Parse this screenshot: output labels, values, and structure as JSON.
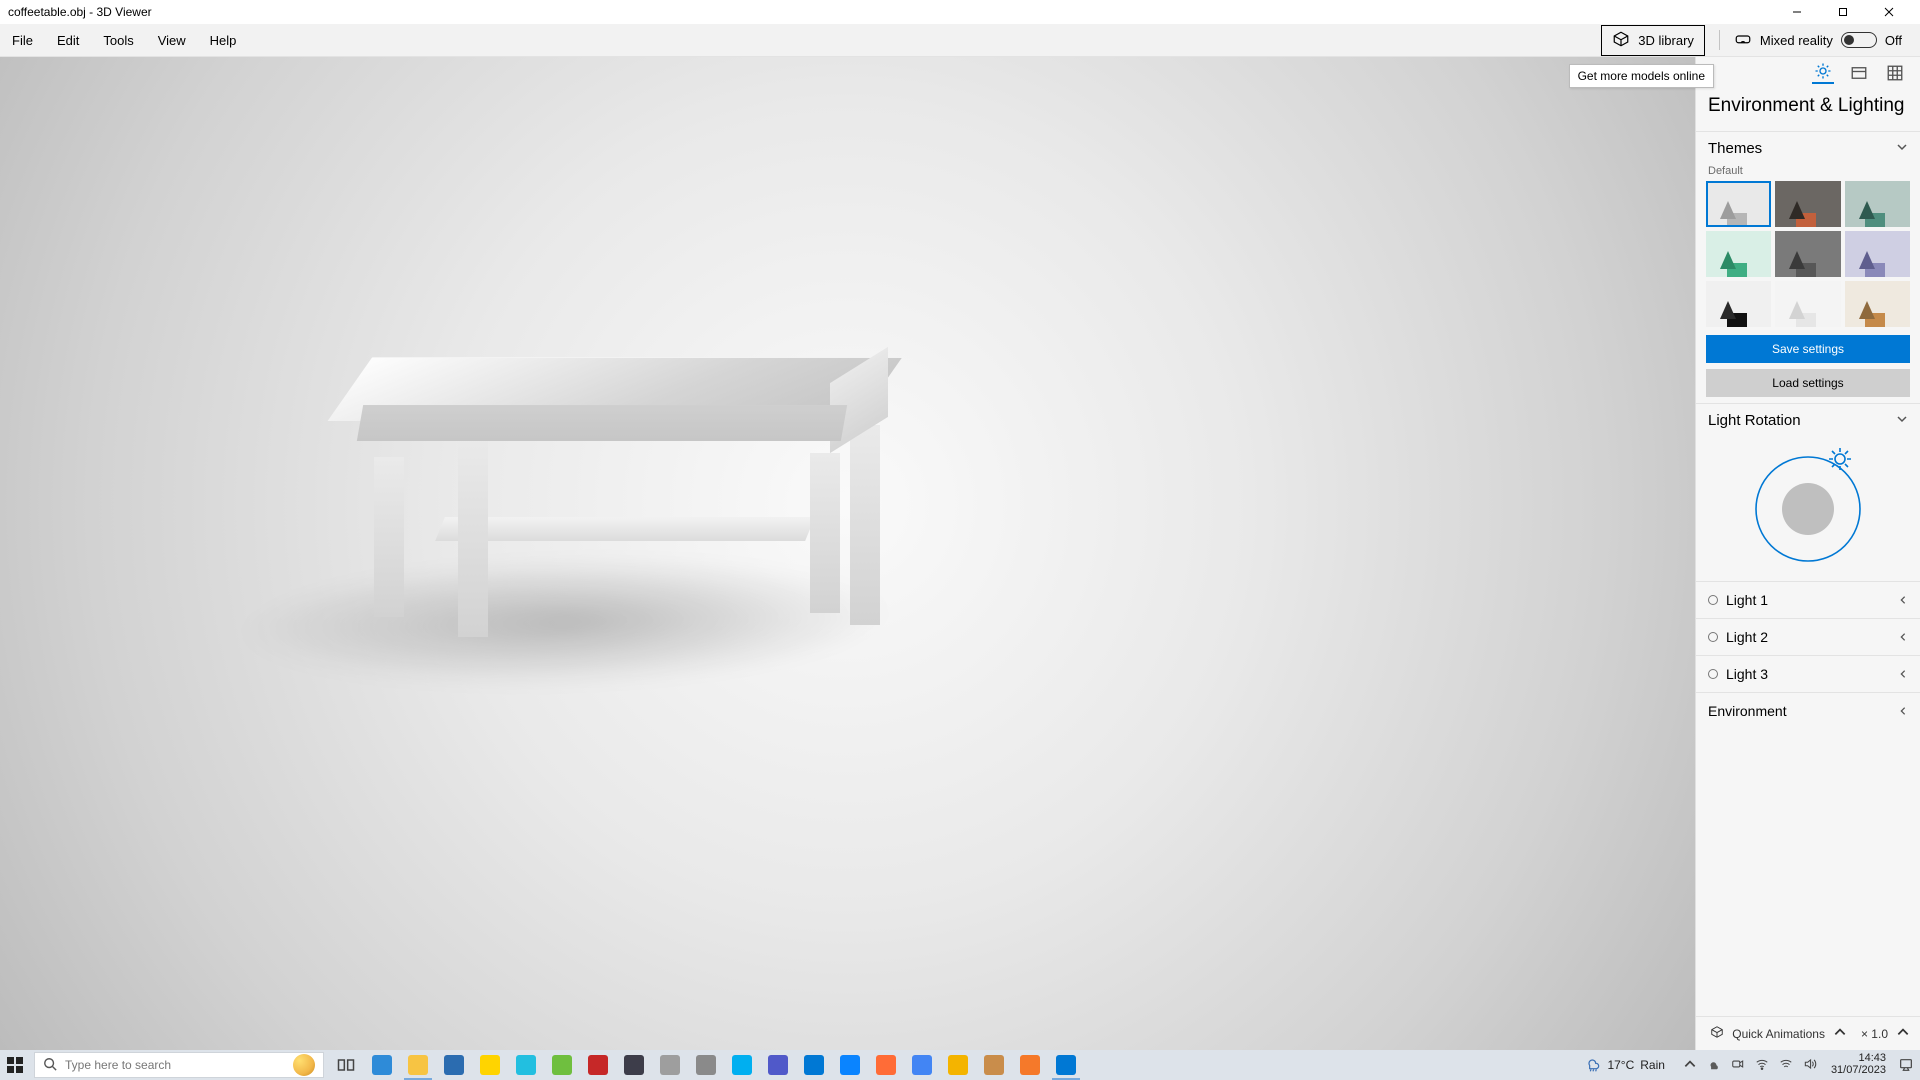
{
  "title": "coffeetable.obj - 3D Viewer",
  "menu": {
    "file": "File",
    "edit": "Edit",
    "tools": "Tools",
    "view": "View",
    "help": "Help"
  },
  "header": {
    "library": "3D library",
    "mixed_reality": "Mixed reality",
    "mr_state": "Off",
    "tooltip": "Get more models online"
  },
  "panel": {
    "title": "Environment & Lighting",
    "themes_label": "Themes",
    "themes_sub": "Default",
    "save": "Save settings",
    "load": "Load settings",
    "light_rotation": "Light Rotation",
    "lights": [
      "Light 1",
      "Light 2",
      "Light 3"
    ],
    "environment": "Environment",
    "quick_anim": "Quick Animations",
    "zoom": "× 1.0",
    "themes": [
      {
        "bg": "#e9e9e9",
        "cube": "#b6b6b6",
        "cone": "#9d9d9d",
        "sel": true
      },
      {
        "bg": "#6b6763",
        "cube": "#c2603c",
        "cone": "#2f2a26",
        "sel": false
      },
      {
        "bg": "#b6c9c4",
        "cube": "#4f8e7e",
        "cone": "#2e5a50",
        "sel": false
      },
      {
        "bg": "#d9efe6",
        "cube": "#3fae83",
        "cone": "#2c8b66",
        "sel": false
      },
      {
        "bg": "#7a7a7a",
        "cube": "#575757",
        "cone": "#3a3a3a",
        "sel": false
      },
      {
        "bg": "#cfcfe3",
        "cube": "#8a89b9",
        "cone": "#5f5e8e",
        "sel": false
      },
      {
        "bg": "#f0f0f0",
        "cube": "#111111",
        "cone": "#2a2a2a",
        "sel": false
      },
      {
        "bg": "#f4f4f4",
        "cube": "#e6e6e6",
        "cone": "#d3d3d3",
        "sel": false
      },
      {
        "bg": "#efe9df",
        "cube": "#c58a4a",
        "cone": "#8f6a3d",
        "sel": false
      }
    ]
  },
  "taskbar": {
    "search_placeholder": "Type here to search",
    "weather_temp": "17°C",
    "weather_label": "Rain",
    "time": "14:43",
    "date": "31/07/2023",
    "apps": [
      {
        "name": "task-view",
        "color": "transparent"
      },
      {
        "name": "edge",
        "color": "#2e8bd8"
      },
      {
        "name": "file-explorer",
        "color": "#f7c443",
        "active": true
      },
      {
        "name": "microsoft-store",
        "color": "#2b6cb0"
      },
      {
        "name": "app-yellow",
        "color": "#ffd400"
      },
      {
        "name": "app-cyan",
        "color": "#22bfe0"
      },
      {
        "name": "app-green",
        "color": "#6fbf3f"
      },
      {
        "name": "app-red-v",
        "color": "#c62828"
      },
      {
        "name": "app-dark1",
        "color": "#3d3d4a"
      },
      {
        "name": "app-grey-diamond",
        "color": "#9e9e9e"
      },
      {
        "name": "app-grey-sphere",
        "color": "#8a8a8a"
      },
      {
        "name": "skype",
        "color": "#00aff0"
      },
      {
        "name": "teams",
        "color": "#5059c9"
      },
      {
        "name": "vscode",
        "color": "#0078d4"
      },
      {
        "name": "thunderbird",
        "color": "#0a84ff"
      },
      {
        "name": "postman",
        "color": "#ff6c37"
      },
      {
        "name": "chrome-alt",
        "color": "#4285f4"
      },
      {
        "name": "chrome",
        "color": "#f4b400"
      },
      {
        "name": "app-cube",
        "color": "#c98d4b"
      },
      {
        "name": "blender",
        "color": "#f5792a"
      },
      {
        "name": "3d-viewer",
        "color": "#0078d4",
        "active": true
      }
    ]
  }
}
